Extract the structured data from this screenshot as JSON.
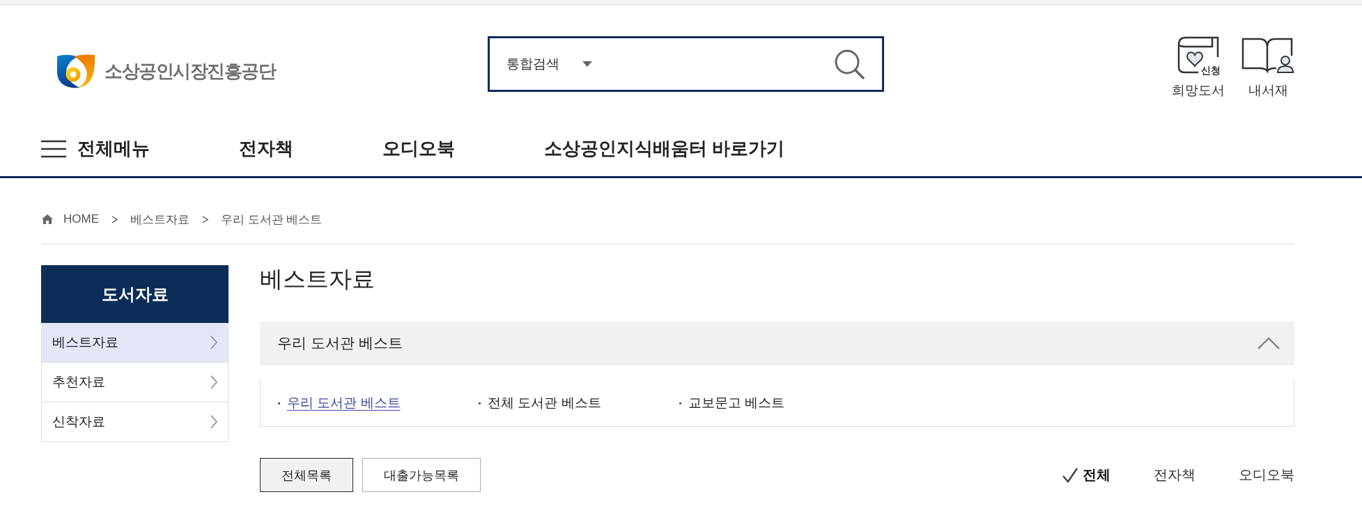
{
  "header": {
    "logo": {
      "text": "소상공인시장진흥공단"
    },
    "search": {
      "scope": "통합검색"
    },
    "quick_links": [
      {
        "kind": "wish",
        "label": "희망도서",
        "badge": "신청"
      },
      {
        "kind": "shelf",
        "label": "내서재"
      }
    ]
  },
  "nav": {
    "menu_label": "전체메뉴",
    "items": [
      "전자책",
      "오디오북",
      "소상공인지식배움터 바로가기"
    ]
  },
  "breadcrumb": [
    "HOME",
    "베스트자료",
    "우리 도서관 베스트"
  ],
  "sidebar": {
    "title": "도서자료",
    "items": [
      {
        "label": "베스트자료",
        "selected": true
      },
      {
        "label": "추천자료",
        "selected": false
      },
      {
        "label": "신착자료",
        "selected": false
      }
    ]
  },
  "page_title": "베스트자료",
  "accordion": {
    "title": "우리 도서관 베스트",
    "expanded": true,
    "tabs": [
      {
        "label": "우리 도서관 베스트",
        "selected": true
      },
      {
        "label": "전체 도서관 베스트",
        "selected": false
      },
      {
        "label": "교보문고 베스트",
        "selected": false
      }
    ]
  },
  "list_buttons": [
    {
      "label": "전체목록",
      "selected": true
    },
    {
      "label": "대출가능목록",
      "selected": false
    }
  ],
  "format_filters": [
    {
      "label": "전체",
      "selected": true
    },
    {
      "label": "전자책",
      "selected": false
    },
    {
      "label": "오디오북",
      "selected": false
    }
  ]
}
